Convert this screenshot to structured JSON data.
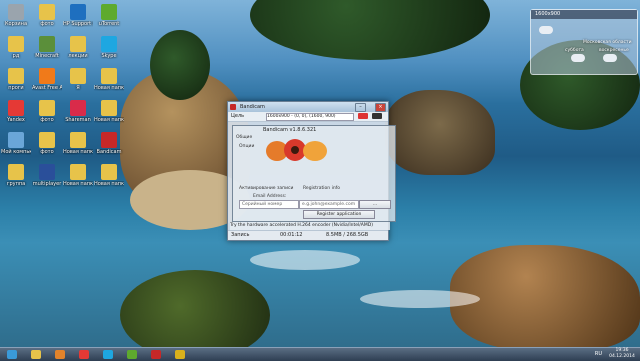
{
  "desktop": {
    "icons": [
      {
        "label": "Корзина",
        "color": "#9aa4ad",
        "glyph": "trash-icon"
      },
      {
        "label": "рд",
        "color": "#e7c34a",
        "glyph": "folder-icon"
      },
      {
        "label": "проги",
        "color": "#e7c34a",
        "glyph": "folder-icon"
      },
      {
        "label": "Yandex",
        "color": "#e53935",
        "glyph": "yandex-icon"
      },
      {
        "label": "Мой компьютер",
        "color": "#6aa6d8",
        "glyph": "computer-icon"
      },
      {
        "label": "группа",
        "color": "#e7c34a",
        "glyph": "folder-icon"
      },
      {
        "label": "фото",
        "color": "#e7c34a",
        "glyph": "folder-icon"
      },
      {
        "label": "Minecraft",
        "color": "#5b8f3a",
        "glyph": "minecraft-icon"
      },
      {
        "label": "Avast Free Antivirus",
        "color": "#f07a1a",
        "glyph": "avast-icon"
      },
      {
        "label": "фото",
        "color": "#e7c34a",
        "glyph": "folder-icon"
      },
      {
        "label": "фото",
        "color": "#e7c34a",
        "glyph": "folder-icon"
      },
      {
        "label": "multiplayer",
        "color": "#2a4f9a",
        "glyph": "app-icon"
      },
      {
        "label": "HP Support Assistant",
        "color": "#1e6fbf",
        "glyph": "hp-icon"
      },
      {
        "label": "лекции",
        "color": "#e7c34a",
        "glyph": "folder-icon"
      },
      {
        "label": "Я",
        "color": "#e7c34a",
        "glyph": "folder-icon"
      },
      {
        "label": "Shareman",
        "color": "#d92b4a",
        "glyph": "app-icon"
      },
      {
        "label": "Новая папка",
        "color": "#e7c34a",
        "glyph": "folder-icon"
      },
      {
        "label": "Новая папка",
        "color": "#e7c34a",
        "glyph": "folder-icon"
      },
      {
        "label": "uTorrent",
        "color": "#5eaa2e",
        "glyph": "utorrent-icon"
      },
      {
        "label": "Skype",
        "color": "#1ea7e1",
        "glyph": "skype-icon"
      },
      {
        "label": "Новая папка",
        "color": "#e7c34a",
        "glyph": "folder-icon"
      },
      {
        "label": "Новая папка",
        "color": "#e7c34a",
        "glyph": "folder-icon"
      },
      {
        "label": "Bandicam",
        "color": "#c62828",
        "glyph": "bandicam-icon"
      },
      {
        "label": "Новая папка",
        "color": "#e7c34a",
        "glyph": "folder-icon"
      }
    ]
  },
  "widget": {
    "header": "1600x900",
    "location": "Московская области",
    "day1": "суббота",
    "day2": "воскресенье"
  },
  "window": {
    "title": "Bandicam",
    "toolbar_label": "Цель",
    "resolution": "1600x900 - (0, 0), (1600, 900)",
    "status_label": "Запись",
    "status_time": "00:01:12",
    "status_size": "8.5MB / 268.5GB"
  },
  "dialog": {
    "title": "Bandicam v1.8.6.321",
    "tab_label": "Общие",
    "section_label": "Опции",
    "reg_left": "Активирование записи",
    "reg_info": "Registration info",
    "email_label": "Email Address:",
    "email_value": "e.g.john@example.com",
    "serial_value": "Серийный номер",
    "register_button": "Register application",
    "footer_note": "Try the hardware accelerated H.264 encoder (Nvidia/Intel/AMD)"
  },
  "taskbar": {
    "items": [
      {
        "name": "start-button",
        "color": "#3a9ad9"
      },
      {
        "name": "taskbar-explorer",
        "color": "#e7c34a"
      },
      {
        "name": "taskbar-media",
        "color": "#e2832b"
      },
      {
        "name": "taskbar-yandex",
        "color": "#e53935"
      },
      {
        "name": "taskbar-skype",
        "color": "#1ea7e1"
      },
      {
        "name": "taskbar-utorrent",
        "color": "#5eaa2e"
      },
      {
        "name": "taskbar-bandicam",
        "color": "#c62828"
      },
      {
        "name": "taskbar-chrome",
        "color": "#d9b11c"
      }
    ],
    "lang": "RU",
    "time": "19:36",
    "date": "04.12.2014"
  }
}
